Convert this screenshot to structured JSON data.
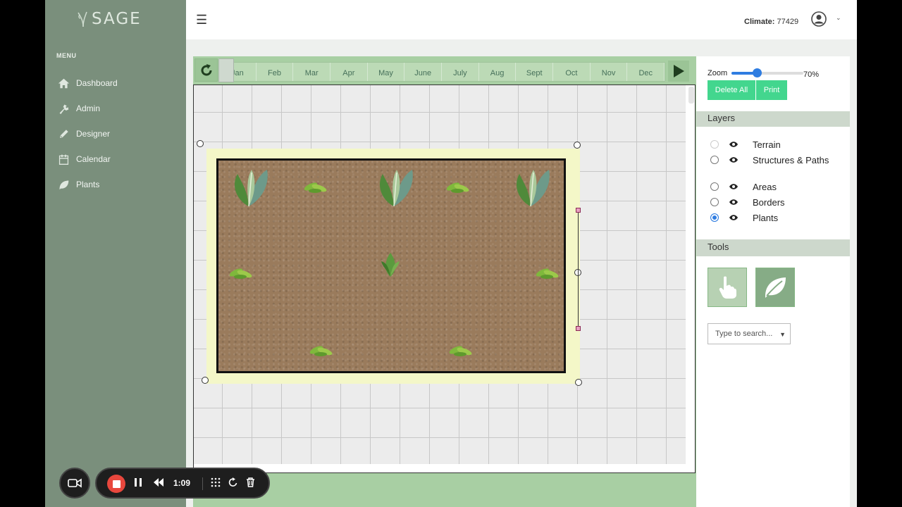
{
  "app": {
    "brand": "SAGE"
  },
  "sidebar": {
    "menu_label": "MENU",
    "items": [
      {
        "label": "Dashboard",
        "icon": "home-icon"
      },
      {
        "label": "Admin",
        "icon": "tools-icon"
      },
      {
        "label": "Designer",
        "icon": "pencil-icon"
      },
      {
        "label": "Calendar",
        "icon": "calendar-icon"
      },
      {
        "label": "Plants",
        "icon": "leaf-icon"
      }
    ]
  },
  "header": {
    "climate_label": "Climate:",
    "climate_value": "77429"
  },
  "timeline": {
    "months": [
      "Jan",
      "Feb",
      "Mar",
      "Apr",
      "May",
      "June",
      "July",
      "Aug",
      "Sept",
      "Oct",
      "Nov",
      "Dec"
    ]
  },
  "panel": {
    "zoom_label": "Zoom",
    "zoom_value": "70%",
    "zoom_fraction": 0.35,
    "delete_all": "Delete All",
    "print": "Print",
    "layers_title": "Layers",
    "layers": [
      {
        "label": "Terrain",
        "selected": false,
        "dim": true
      },
      {
        "label": "Structures & Paths",
        "selected": false,
        "dim": false
      },
      {
        "label": "Areas",
        "selected": false,
        "dim": false
      },
      {
        "label": "Borders",
        "selected": false,
        "dim": false
      },
      {
        "label": "Plants",
        "selected": true,
        "dim": false
      }
    ],
    "tools_title": "Tools",
    "search_placeholder": "Type to search..."
  },
  "recorder": {
    "time": "1:09"
  },
  "colors": {
    "sidebar": "#7a8f7c",
    "accent_green": "#43d68e",
    "timeline": "#a8cfa3",
    "soil": "#9a7b5c"
  }
}
